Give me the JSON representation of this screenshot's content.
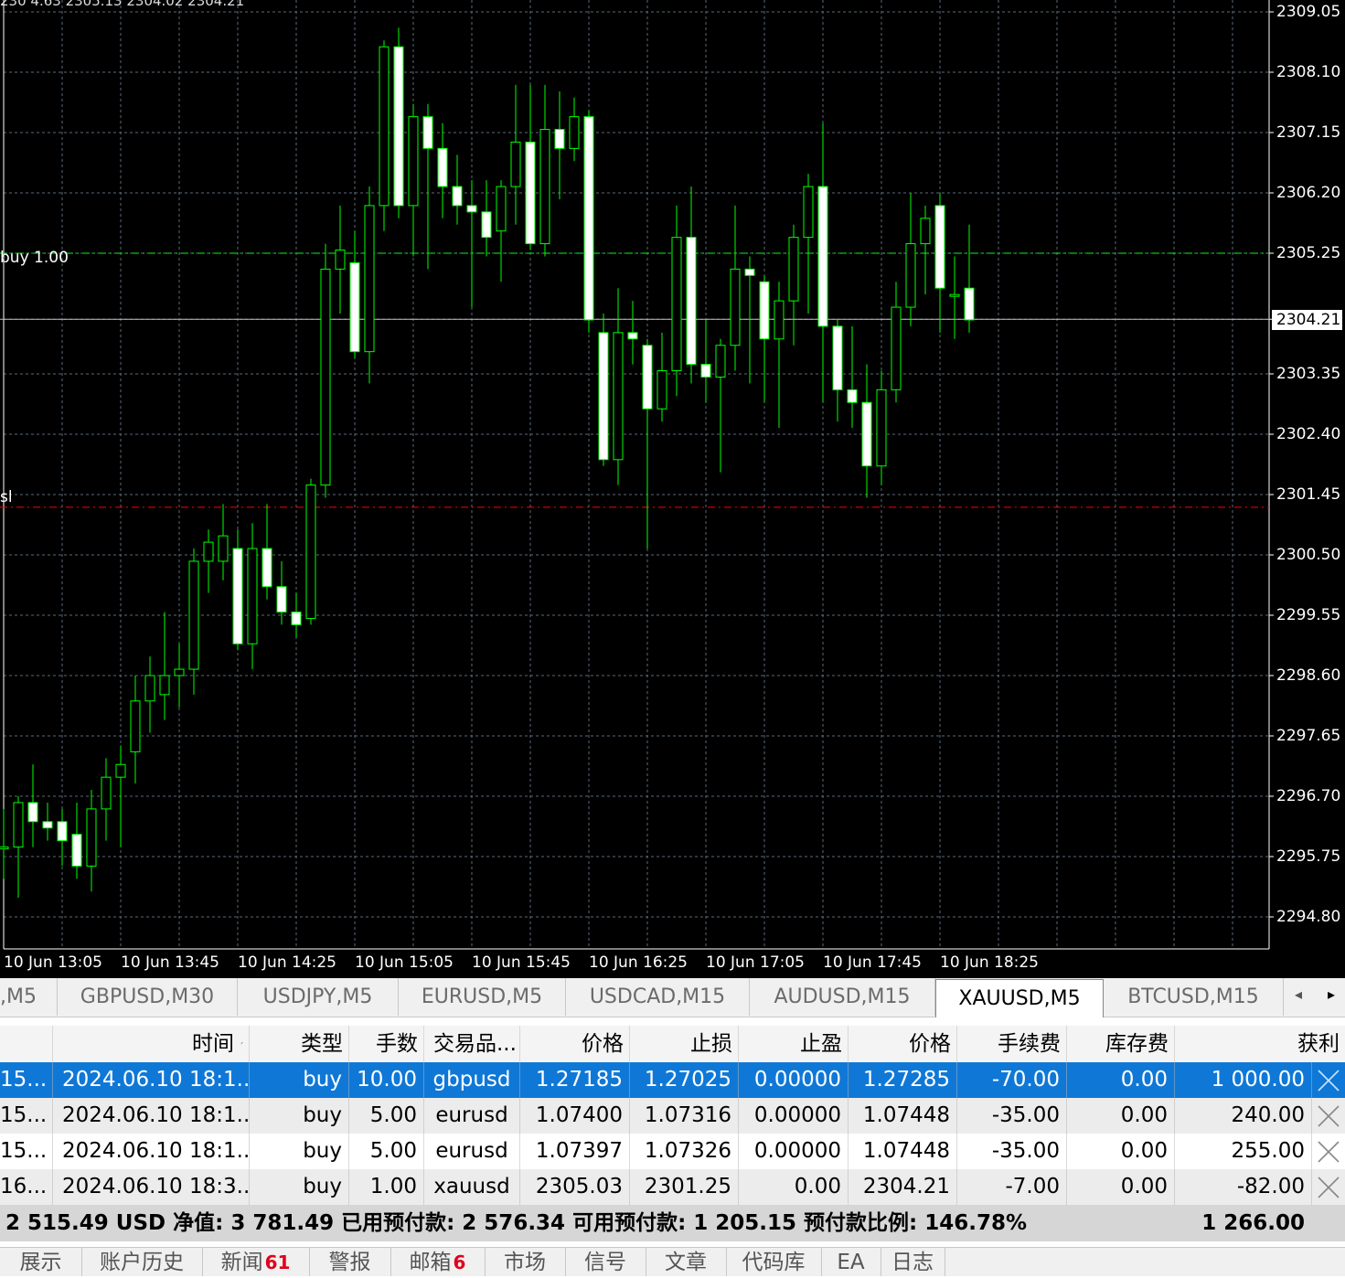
{
  "chart": {
    "symbol": "XAUUSD",
    "timeframe": "M5",
    "ohlc_partial": "230 4.63 2305.13 2304.02 2304.21",
    "line_labels": {
      "buy": "buy 1.00",
      "sl": "sl"
    },
    "current_price": "2304.21",
    "colors": {
      "background": "#000000",
      "bull": "#00ff00",
      "bear_body": "#ffffff",
      "grid": "#5a6a7a",
      "sl_line": "#ff0000",
      "buy_line": "#00ff00"
    }
  },
  "chart_data": {
    "type": "candlestick",
    "ylim": [
      2293.9,
      2309.35
    ],
    "y_ticks": [
      "2309.05",
      "2308.10",
      "2307.15",
      "2306.20",
      "2305.25",
      "2304.21",
      "2303.35",
      "2302.40",
      "2301.45",
      "2300.50",
      "2299.55",
      "2298.60",
      "2297.65",
      "2296.70",
      "2295.75",
      "2294.80"
    ],
    "x_ticks": [
      "10 Jun 13:05",
      "10 Jun 13:45",
      "10 Jun 14:25",
      "10 Jun 15:05",
      "10 Jun 15:45",
      "10 Jun 16:25",
      "10 Jun 17:05",
      "10 Jun 17:45",
      "10 Jun 18:25"
    ],
    "buy_level": 2305.25,
    "sl_level": 2301.25,
    "current_level": 2304.21,
    "candles": [
      {
        "o": 2295.9,
        "h": 2296.5,
        "l": 2295.4,
        "c": 2295.9
      },
      {
        "o": 2295.9,
        "h": 2296.7,
        "l": 2295.1,
        "c": 2296.6
      },
      {
        "o": 2296.6,
        "h": 2297.2,
        "l": 2295.9,
        "c": 2296.3
      },
      {
        "o": 2296.3,
        "h": 2296.6,
        "l": 2296.0,
        "c": 2296.2
      },
      {
        "o": 2296.3,
        "h": 2296.5,
        "l": 2295.6,
        "c": 2296.0
      },
      {
        "o": 2296.1,
        "h": 2296.6,
        "l": 2295.4,
        "c": 2295.6
      },
      {
        "o": 2295.6,
        "h": 2296.8,
        "l": 2295.2,
        "c": 2296.5
      },
      {
        "o": 2296.5,
        "h": 2297.3,
        "l": 2296.0,
        "c": 2297.0
      },
      {
        "o": 2297.0,
        "h": 2297.5,
        "l": 2295.9,
        "c": 2297.2
      },
      {
        "o": 2297.4,
        "h": 2298.6,
        "l": 2296.9,
        "c": 2298.2
      },
      {
        "o": 2298.2,
        "h": 2298.9,
        "l": 2297.7,
        "c": 2298.6
      },
      {
        "o": 2298.3,
        "h": 2299.6,
        "l": 2297.9,
        "c": 2298.6
      },
      {
        "o": 2298.6,
        "h": 2299.1,
        "l": 2298.1,
        "c": 2298.7
      },
      {
        "o": 2298.7,
        "h": 2300.6,
        "l": 2298.3,
        "c": 2300.4
      },
      {
        "o": 2300.4,
        "h": 2300.9,
        "l": 2299.9,
        "c": 2300.7
      },
      {
        "o": 2300.4,
        "h": 2301.3,
        "l": 2300.1,
        "c": 2300.8
      },
      {
        "o": 2300.6,
        "h": 2300.9,
        "l": 2299.0,
        "c": 2299.1
      },
      {
        "o": 2299.1,
        "h": 2301.0,
        "l": 2298.7,
        "c": 2300.6
      },
      {
        "o": 2300.6,
        "h": 2301.3,
        "l": 2299.8,
        "c": 2300.0
      },
      {
        "o": 2300.0,
        "h": 2300.4,
        "l": 2299.4,
        "c": 2299.6
      },
      {
        "o": 2299.6,
        "h": 2299.9,
        "l": 2299.2,
        "c": 2299.4
      },
      {
        "o": 2299.5,
        "h": 2301.7,
        "l": 2299.4,
        "c": 2301.6
      },
      {
        "o": 2301.6,
        "h": 2305.4,
        "l": 2301.4,
        "c": 2305.0
      },
      {
        "o": 2305.0,
        "h": 2306.0,
        "l": 2304.3,
        "c": 2305.3
      },
      {
        "o": 2305.1,
        "h": 2305.6,
        "l": 2303.6,
        "c": 2303.7
      },
      {
        "o": 2303.7,
        "h": 2306.3,
        "l": 2303.2,
        "c": 2306.0
      },
      {
        "o": 2306.0,
        "h": 2308.6,
        "l": 2305.6,
        "c": 2308.5
      },
      {
        "o": 2308.5,
        "h": 2308.8,
        "l": 2305.8,
        "c": 2306.0
      },
      {
        "o": 2306.0,
        "h": 2307.6,
        "l": 2305.2,
        "c": 2307.4
      },
      {
        "o": 2307.4,
        "h": 2307.6,
        "l": 2305.0,
        "c": 2306.9
      },
      {
        "o": 2306.9,
        "h": 2307.3,
        "l": 2305.8,
        "c": 2306.3
      },
      {
        "o": 2306.3,
        "h": 2306.8,
        "l": 2305.7,
        "c": 2306.0
      },
      {
        "o": 2306.0,
        "h": 2306.4,
        "l": 2304.4,
        "c": 2305.9
      },
      {
        "o": 2305.9,
        "h": 2306.4,
        "l": 2305.2,
        "c": 2305.5
      },
      {
        "o": 2305.6,
        "h": 2306.4,
        "l": 2304.8,
        "c": 2306.3
      },
      {
        "o": 2306.3,
        "h": 2307.9,
        "l": 2305.7,
        "c": 2307.0
      },
      {
        "o": 2307.0,
        "h": 2307.9,
        "l": 2305.3,
        "c": 2305.4
      },
      {
        "o": 2305.4,
        "h": 2307.9,
        "l": 2305.2,
        "c": 2307.2
      },
      {
        "o": 2307.2,
        "h": 2307.8,
        "l": 2306.1,
        "c": 2306.9
      },
      {
        "o": 2306.9,
        "h": 2307.7,
        "l": 2306.7,
        "c": 2307.4
      },
      {
        "o": 2307.4,
        "h": 2307.5,
        "l": 2304.0,
        "c": 2304.2
      },
      {
        "o": 2304.0,
        "h": 2304.3,
        "l": 2301.9,
        "c": 2302.0
      },
      {
        "o": 2302.0,
        "h": 2304.7,
        "l": 2301.6,
        "c": 2304.0
      },
      {
        "o": 2304.0,
        "h": 2304.5,
        "l": 2303.5,
        "c": 2303.9
      },
      {
        "o": 2303.8,
        "h": 2303.9,
        "l": 2300.6,
        "c": 2302.8
      },
      {
        "o": 2302.8,
        "h": 2304.0,
        "l": 2302.6,
        "c": 2303.4
      },
      {
        "o": 2303.4,
        "h": 2306.0,
        "l": 2303.0,
        "c": 2305.5
      },
      {
        "o": 2305.5,
        "h": 2306.3,
        "l": 2303.2,
        "c": 2303.5
      },
      {
        "o": 2303.5,
        "h": 2304.2,
        "l": 2302.9,
        "c": 2303.3
      },
      {
        "o": 2303.3,
        "h": 2303.9,
        "l": 2301.8,
        "c": 2303.8
      },
      {
        "o": 2303.8,
        "h": 2306.0,
        "l": 2303.4,
        "c": 2305.0
      },
      {
        "o": 2305.0,
        "h": 2305.2,
        "l": 2303.2,
        "c": 2304.9
      },
      {
        "o": 2304.8,
        "h": 2304.9,
        "l": 2302.9,
        "c": 2303.9
      },
      {
        "o": 2303.9,
        "h": 2304.8,
        "l": 2302.5,
        "c": 2304.5
      },
      {
        "o": 2304.5,
        "h": 2305.7,
        "l": 2303.8,
        "c": 2305.5
      },
      {
        "o": 2305.5,
        "h": 2306.5,
        "l": 2304.3,
        "c": 2306.3
      },
      {
        "o": 2306.3,
        "h": 2307.3,
        "l": 2302.9,
        "c": 2304.1
      },
      {
        "o": 2304.1,
        "h": 2304.2,
        "l": 2302.6,
        "c": 2303.1
      },
      {
        "o": 2303.1,
        "h": 2304.1,
        "l": 2302.5,
        "c": 2302.9
      },
      {
        "o": 2302.9,
        "h": 2303.5,
        "l": 2301.4,
        "c": 2301.9
      },
      {
        "o": 2301.9,
        "h": 2303.4,
        "l": 2301.6,
        "c": 2303.1
      },
      {
        "o": 2303.1,
        "h": 2304.8,
        "l": 2302.9,
        "c": 2304.4
      },
      {
        "o": 2304.4,
        "h": 2306.2,
        "l": 2304.1,
        "c": 2305.4
      },
      {
        "o": 2305.4,
        "h": 2306.0,
        "l": 2304.6,
        "c": 2305.8
      },
      {
        "o": 2306.0,
        "h": 2306.2,
        "l": 2304.0,
        "c": 2304.7
      },
      {
        "o": 2304.6,
        "h": 2305.2,
        "l": 2303.9,
        "c": 2304.6
      },
      {
        "o": 2304.7,
        "h": 2305.7,
        "l": 2304.0,
        "c": 2304.2
      }
    ]
  },
  "symbol_tabs": [
    "M5",
    "GBPUSD,M30",
    "USDJPY,M5",
    "EURUSD,M5",
    "USDCAD,M15",
    "AUDUSD,M15",
    "XAUUSD,M5",
    "BTCUSD,M15"
  ],
  "symbol_tabs_first_prefix": ",",
  "active_symbol_tab": "XAUUSD,M5",
  "trade_table": {
    "columns": [
      "时间",
      "类型",
      "手数",
      "交易品...",
      "价格",
      "止损",
      "止盈",
      "价格",
      "手续费",
      "库存费",
      "获利"
    ],
    "sort_indicator": "′",
    "rows": [
      {
        "order": "15...",
        "time": "2024.06.10 18:1...",
        "type": "buy",
        "lots": "10.00",
        "symbol": "gbpusd",
        "price": "1.27185",
        "sl": "1.27025",
        "tp": "0.00000",
        "cur": "1.27285",
        "commission": "-70.00",
        "swap": "0.00",
        "profit": "1 000.00"
      },
      {
        "order": "15...",
        "time": "2024.06.10 18:1...",
        "type": "buy",
        "lots": "5.00",
        "symbol": "eurusd",
        "price": "1.07400",
        "sl": "1.07316",
        "tp": "0.00000",
        "cur": "1.07448",
        "commission": "-35.00",
        "swap": "0.00",
        "profit": "240.00"
      },
      {
        "order": "15...",
        "time": "2024.06.10 18:1...",
        "type": "buy",
        "lots": "5.00",
        "symbol": "eurusd",
        "price": "1.07397",
        "sl": "1.07326",
        "tp": "0.00000",
        "cur": "1.07448",
        "commission": "-35.00",
        "swap": "0.00",
        "profit": "255.00"
      },
      {
        "order": "16...",
        "time": "2024.06.10 18:3...",
        "type": "buy",
        "lots": "1.00",
        "symbol": "xauusd",
        "price": "2305.03",
        "sl": "2301.25",
        "tp": "0.00",
        "cur": "2304.21",
        "commission": "-7.00",
        "swap": "0.00",
        "profit": "-82.00"
      }
    ],
    "balance_line": "2 515.49 USD  净值: 3 781.49  已用预付款: 2 576.34  可用预付款: 1 205.15  预付款比例: 146.78%",
    "total_profit": "1 266.00"
  },
  "bottom_tabs": [
    {
      "label": "展示",
      "badge": ""
    },
    {
      "label": "账户历史",
      "badge": ""
    },
    {
      "label": "新闻",
      "badge": "61"
    },
    {
      "label": "警报",
      "badge": ""
    },
    {
      "label": "邮箱",
      "badge": "6"
    },
    {
      "label": "市场",
      "badge": ""
    },
    {
      "label": "信号",
      "badge": ""
    },
    {
      "label": "文章",
      "badge": ""
    },
    {
      "label": "代码库",
      "badge": ""
    },
    {
      "label": "EA",
      "badge": ""
    },
    {
      "label": "日志",
      "badge": ""
    }
  ]
}
